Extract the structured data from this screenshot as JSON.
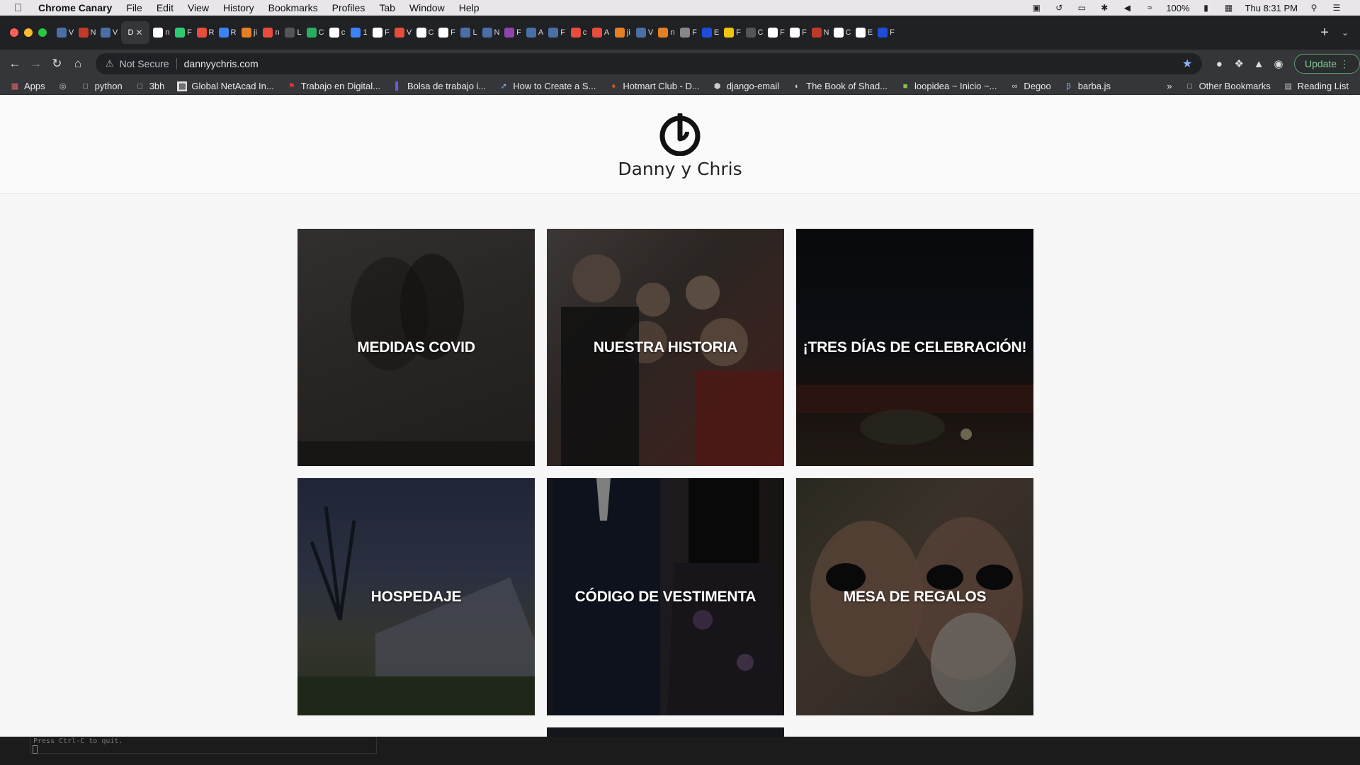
{
  "menubar": {
    "app_name": "Chrome Canary",
    "items": [
      "File",
      "Edit",
      "View",
      "History",
      "Bookmarks",
      "Profiles",
      "Tab",
      "Window",
      "Help"
    ],
    "battery": "100%",
    "clock": "Thu 8:31 PM"
  },
  "tabs": {
    "items": [
      {
        "letter": "V",
        "color": "#4a6fa5"
      },
      {
        "letter": "N",
        "color": "#c0392b"
      },
      {
        "letter": "V",
        "color": "#4a6fa5"
      },
      {
        "letter": "D",
        "color": "#35363a",
        "active": true
      },
      {
        "letter": "n",
        "color": "#ffffff"
      },
      {
        "letter": "F",
        "color": "#2ecc71"
      },
      {
        "letter": "R",
        "color": "#e74c3c"
      },
      {
        "letter": "R",
        "color": "#3b82f6"
      },
      {
        "letter": "ji",
        "color": "#e67e22"
      },
      {
        "letter": "n",
        "color": "#e74c3c"
      },
      {
        "letter": "L",
        "color": "#555555"
      },
      {
        "letter": "C",
        "color": "#27ae60"
      },
      {
        "letter": "c",
        "color": "#ffffff"
      },
      {
        "letter": "1",
        "color": "#3b82f6"
      },
      {
        "letter": "F",
        "color": "#ffffff"
      },
      {
        "letter": "V",
        "color": "#e74c3c"
      },
      {
        "letter": "C",
        "color": "#ffffff"
      },
      {
        "letter": "F",
        "color": "#ffffff"
      },
      {
        "letter": "L",
        "color": "#4a6fa5"
      },
      {
        "letter": "N",
        "color": "#4a6fa5"
      },
      {
        "letter": "F",
        "color": "#8e44ad"
      },
      {
        "letter": "A",
        "color": "#4a6fa5"
      },
      {
        "letter": "F",
        "color": "#4a6fa5"
      },
      {
        "letter": "c",
        "color": "#e74c3c"
      },
      {
        "letter": "A",
        "color": "#e74c3c"
      },
      {
        "letter": "ji",
        "color": "#e67e22"
      },
      {
        "letter": "V",
        "color": "#4a6fa5"
      },
      {
        "letter": "n",
        "color": "#e67e22"
      },
      {
        "letter": "F",
        "color": "#888888"
      },
      {
        "letter": "E",
        "color": "#1d4ed8"
      },
      {
        "letter": "F",
        "color": "#f1c40f"
      },
      {
        "letter": "C",
        "color": "#555555"
      },
      {
        "letter": "F",
        "color": "#ffffff"
      },
      {
        "letter": "F",
        "color": "#ffffff"
      },
      {
        "letter": "N",
        "color": "#c0392b"
      },
      {
        "letter": "C",
        "color": "#ffffff"
      },
      {
        "letter": "E",
        "color": "#ffffff"
      },
      {
        "letter": "F",
        "color": "#1d4ed8"
      }
    ],
    "active_close": "✕",
    "new_tab": "+"
  },
  "toolbar": {
    "security_label": "Not Secure",
    "url": "dannyychris.com",
    "update_label": "Update"
  },
  "bookmarks": {
    "items": [
      "Apps",
      "",
      "python",
      "3bh",
      "Global NetAcad In...",
      "Trabajo en Digital...",
      "Bolsa de trabajo i...",
      "How to Create a S...",
      "Hotmart Club - D...",
      "django-email",
      "The Book of Shad...",
      "loopidea ~ Inicio ~...",
      "Degoo",
      "barba.js"
    ],
    "overflow": "»",
    "other": "Other Bookmarks",
    "reading_list": "Reading List"
  },
  "site": {
    "title": "Danny y Chris",
    "cards": [
      {
        "label": "MEDIDAS COVID"
      },
      {
        "label": "NUESTRA HISTORIA"
      },
      {
        "label": "¡TRES DÍAS DE CELEBRACIÓN!"
      },
      {
        "label": "HOSPEDAJE"
      },
      {
        "label": "CÓDIGO DE VESTIMENTA"
      },
      {
        "label": "MESA DE REGALOS"
      }
    ]
  },
  "terminal": {
    "text": "Press Ctrl-C to quit."
  },
  "colors": {
    "omnibox_star": "#8ab4f8",
    "update_green": "#81c995",
    "page_bg": "#f7f7f7",
    "card_text": "#ffffff"
  }
}
